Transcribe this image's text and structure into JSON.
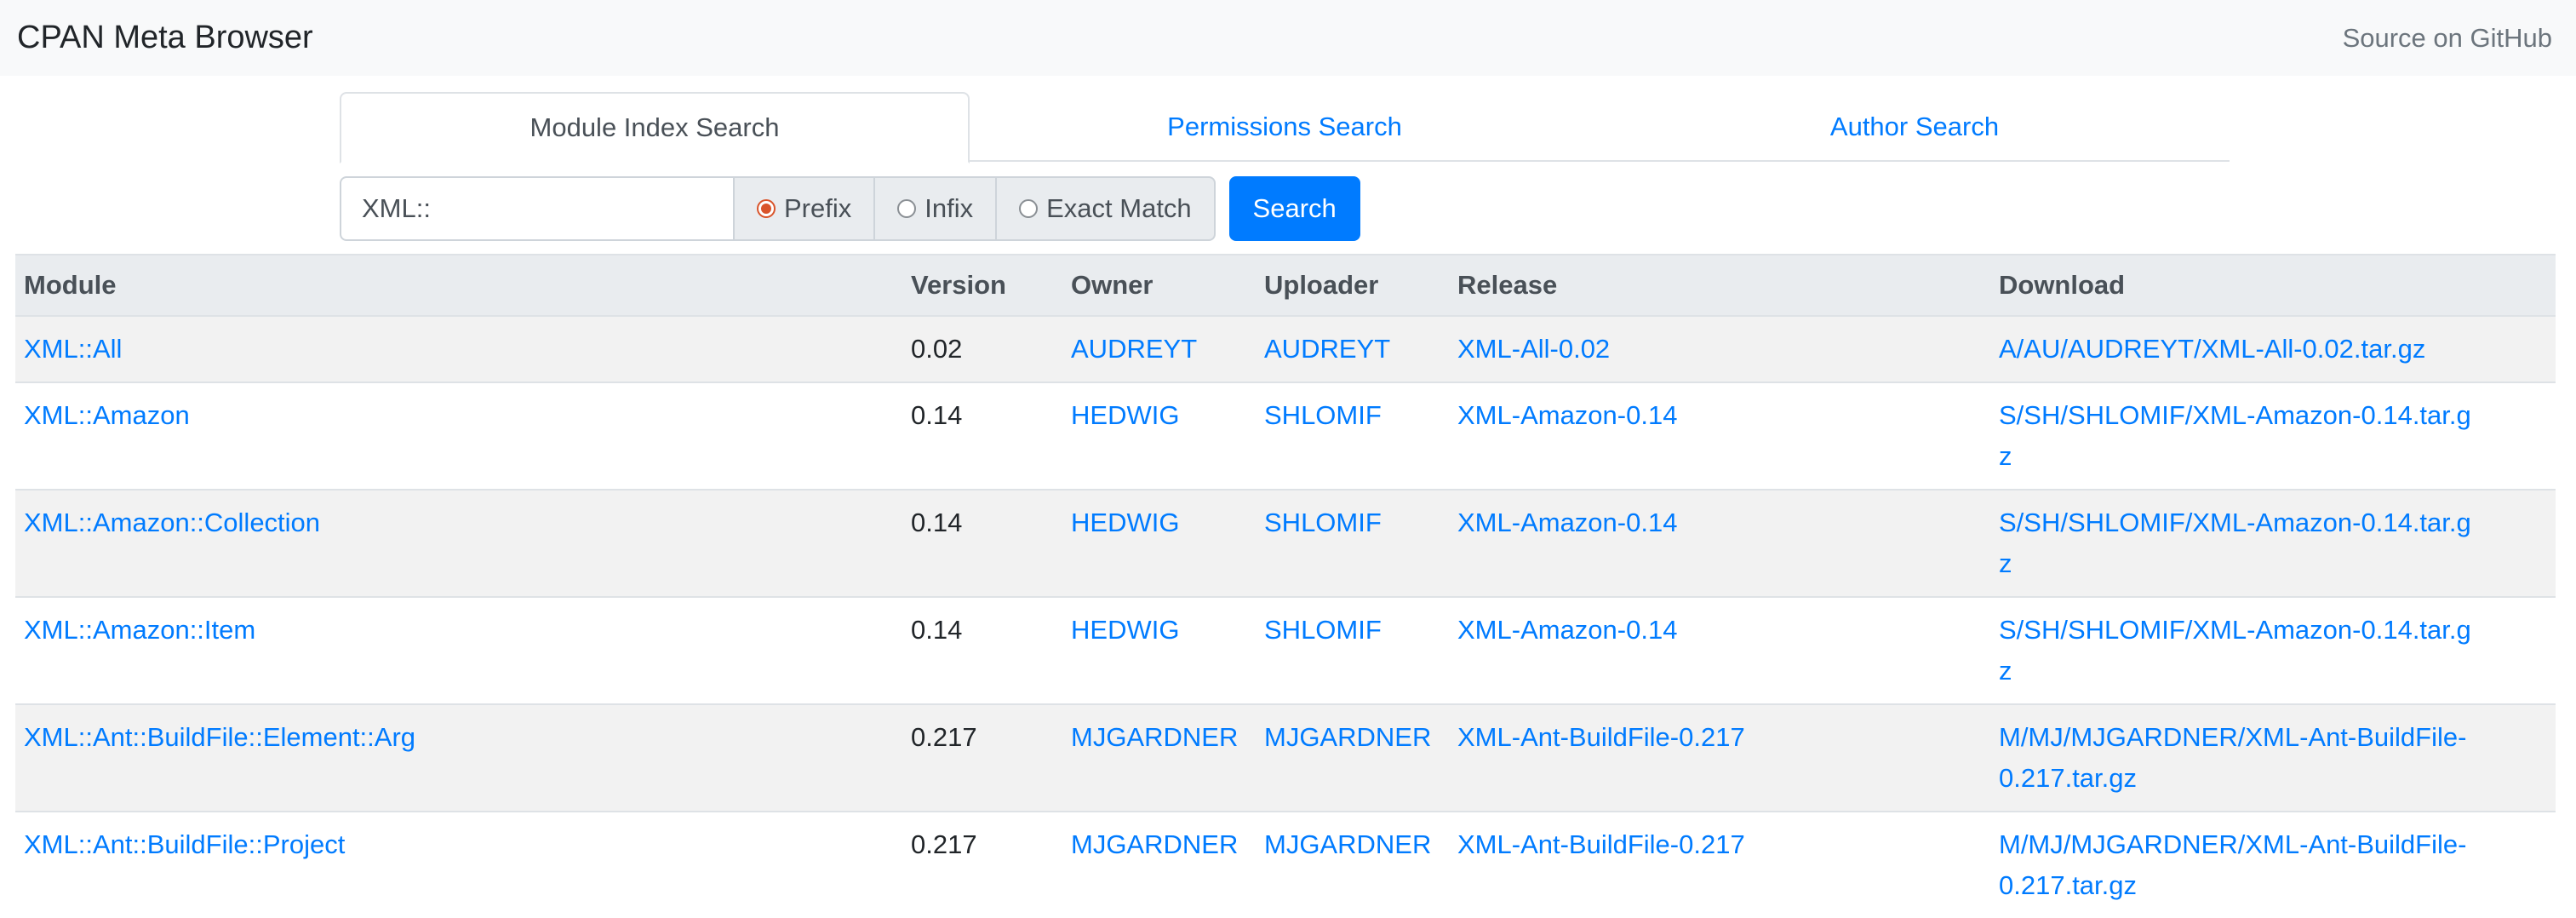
{
  "navbar": {
    "brand": "CPAN Meta Browser",
    "github_link": "Source on GitHub"
  },
  "tabs": [
    {
      "label": "Module Index Search",
      "active": true
    },
    {
      "label": "Permissions Search",
      "active": false
    },
    {
      "label": "Author Search",
      "active": false
    }
  ],
  "search": {
    "value": "XML::",
    "modes": [
      {
        "label": "Prefix",
        "checked": true
      },
      {
        "label": "Infix",
        "checked": false
      },
      {
        "label": "Exact Match",
        "checked": false
      }
    ],
    "button_label": "Search"
  },
  "table": {
    "headers": {
      "module": "Module",
      "version": "Version",
      "owner": "Owner",
      "uploader": "Uploader",
      "release": "Release",
      "download": "Download"
    },
    "rows": [
      {
        "module": "XML::All",
        "version": "0.02",
        "owner": "AUDREYT",
        "uploader": "AUDREYT",
        "release": "XML-All-0.02",
        "download": "A/AU/AUDREYT/XML-All-0.02.tar.gz"
      },
      {
        "module": "XML::Amazon",
        "version": "0.14",
        "owner": "HEDWIG",
        "uploader": "SHLOMIF",
        "release": "XML-Amazon-0.14",
        "download": "S/SH/SHLOMIF/XML-Amazon-0.14.tar.gz"
      },
      {
        "module": "XML::Amazon::Collection",
        "version": "0.14",
        "owner": "HEDWIG",
        "uploader": "SHLOMIF",
        "release": "XML-Amazon-0.14",
        "download": "S/SH/SHLOMIF/XML-Amazon-0.14.tar.gz"
      },
      {
        "module": "XML::Amazon::Item",
        "version": "0.14",
        "owner": "HEDWIG",
        "uploader": "SHLOMIF",
        "release": "XML-Amazon-0.14",
        "download": "S/SH/SHLOMIF/XML-Amazon-0.14.tar.gz"
      },
      {
        "module": "XML::Ant::BuildFile::Element::Arg",
        "version": "0.217",
        "owner": "MJGARDNER",
        "uploader": "MJGARDNER",
        "release": "XML-Ant-BuildFile-0.217",
        "download": "M/MJ/MJGARDNER/XML-Ant-BuildFile-0.217.tar.gz"
      },
      {
        "module": "XML::Ant::BuildFile::Project",
        "version": "0.217",
        "owner": "MJGARDNER",
        "uploader": "MJGARDNER",
        "release": "XML-Ant-BuildFile-0.217",
        "download": "M/MJ/MJGARDNER/XML-Ant-BuildFile-0.217.tar.gz"
      }
    ]
  }
}
